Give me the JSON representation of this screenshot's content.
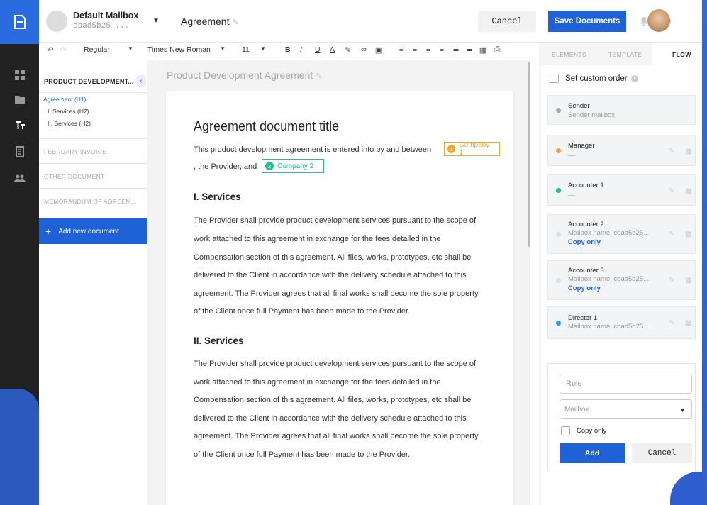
{
  "header": {
    "mailbox_name": "Default Mailbox",
    "mailbox_id": "cbad5b25 ...",
    "document_title": "Agreement",
    "cancel_label": "Cancel",
    "save_label": "Save Documents"
  },
  "toolbar": {
    "style": "Regular",
    "font": "Times New Roman",
    "size": "11",
    "bold": "B",
    "italic": "I",
    "underline": "U",
    "font_color": "A"
  },
  "docnav": {
    "current_doc": "PRODUCT DEVELOPMENT...",
    "outline": [
      "Agreement (H1)",
      "I. Services (H2)",
      "II. Services (H2)"
    ],
    "other_docs": [
      "FEBRUARY INVOICE",
      "OTHER DOCUMENT",
      "MEMORANDUM OF AGREEM..."
    ],
    "add_label": "Add new document"
  },
  "editor": {
    "heading": "Product Development Agreement",
    "title": "Agreement document title",
    "intro_1": "This product development agreement is entered into by and between",
    "intro_2": ", the Provider, and",
    "chip1": {
      "num": "1",
      "label": "Company 1",
      "color": "#f5a623"
    },
    "chip2": {
      "num": "2",
      "label": "Company 2",
      "color": "#22c08a"
    },
    "sections": [
      {
        "title": "I. Services",
        "lines": [
          "The Provider shall provide product development services pursuant to the scope of",
          "work attached to this agreement in exchange for the fees detailed in the",
          "Compensation section of this agreement. All files, works, prototypes, etc shall be",
          "delivered to the Client in accordance with the delivery schedule attached to this",
          "agreement. The Provider agrees that all final works shall become the sole property",
          "of the Client once full Payment has been made to the Provider."
        ]
      },
      {
        "title": "II. Services",
        "lines": [
          "The Provider shall provide product development services pursuant to the scope of",
          "work attached to this agreement in exchange for the fees detailed in the",
          "Compensation section of this agreement. All files, works, prototypes, etc shall be",
          "delivered to the Client in accordance with the delivery schedule attached to this",
          "agreement. The Provider agrees that all final works shall become the sole property",
          "of the Client once full Payment has been made to the Provider."
        ]
      }
    ]
  },
  "panel": {
    "tabs": [
      "ELEMENTS",
      "TEMPLATE",
      "FLOW"
    ],
    "active_tab": "FLOW",
    "custom_order_label": "Set custom order",
    "recipients": [
      {
        "name": "Sender",
        "sub": "Sender mailbox",
        "color": "#aaaaaa"
      },
      {
        "name": "Manager",
        "sub": "—",
        "color": "#f5a623"
      },
      {
        "name": "Accounter 1",
        "sub": "—",
        "color": "#22c08a"
      },
      {
        "name": "Accounter 2",
        "sub": "Mailbox name: cbad5b25...",
        "copy": "Copy only",
        "color": "#dddddd"
      },
      {
        "name": "Accounter 3",
        "sub": "Mailbox name: cbad5b25...",
        "copy": "Copy only",
        "color": "#dddddd"
      },
      {
        "name": "Director 1",
        "sub": "Mailbox name: cbad5b25...",
        "color": "#1da1f2"
      }
    ],
    "form": {
      "role_placeholder": "Role",
      "mailbox_placeholder": "Mailbox",
      "copy_only_label": "Copy only",
      "add_label": "Add",
      "cancel_label": "Cancel"
    }
  },
  "colors": {
    "accent": "#1f61d6",
    "rail": "#222222"
  }
}
